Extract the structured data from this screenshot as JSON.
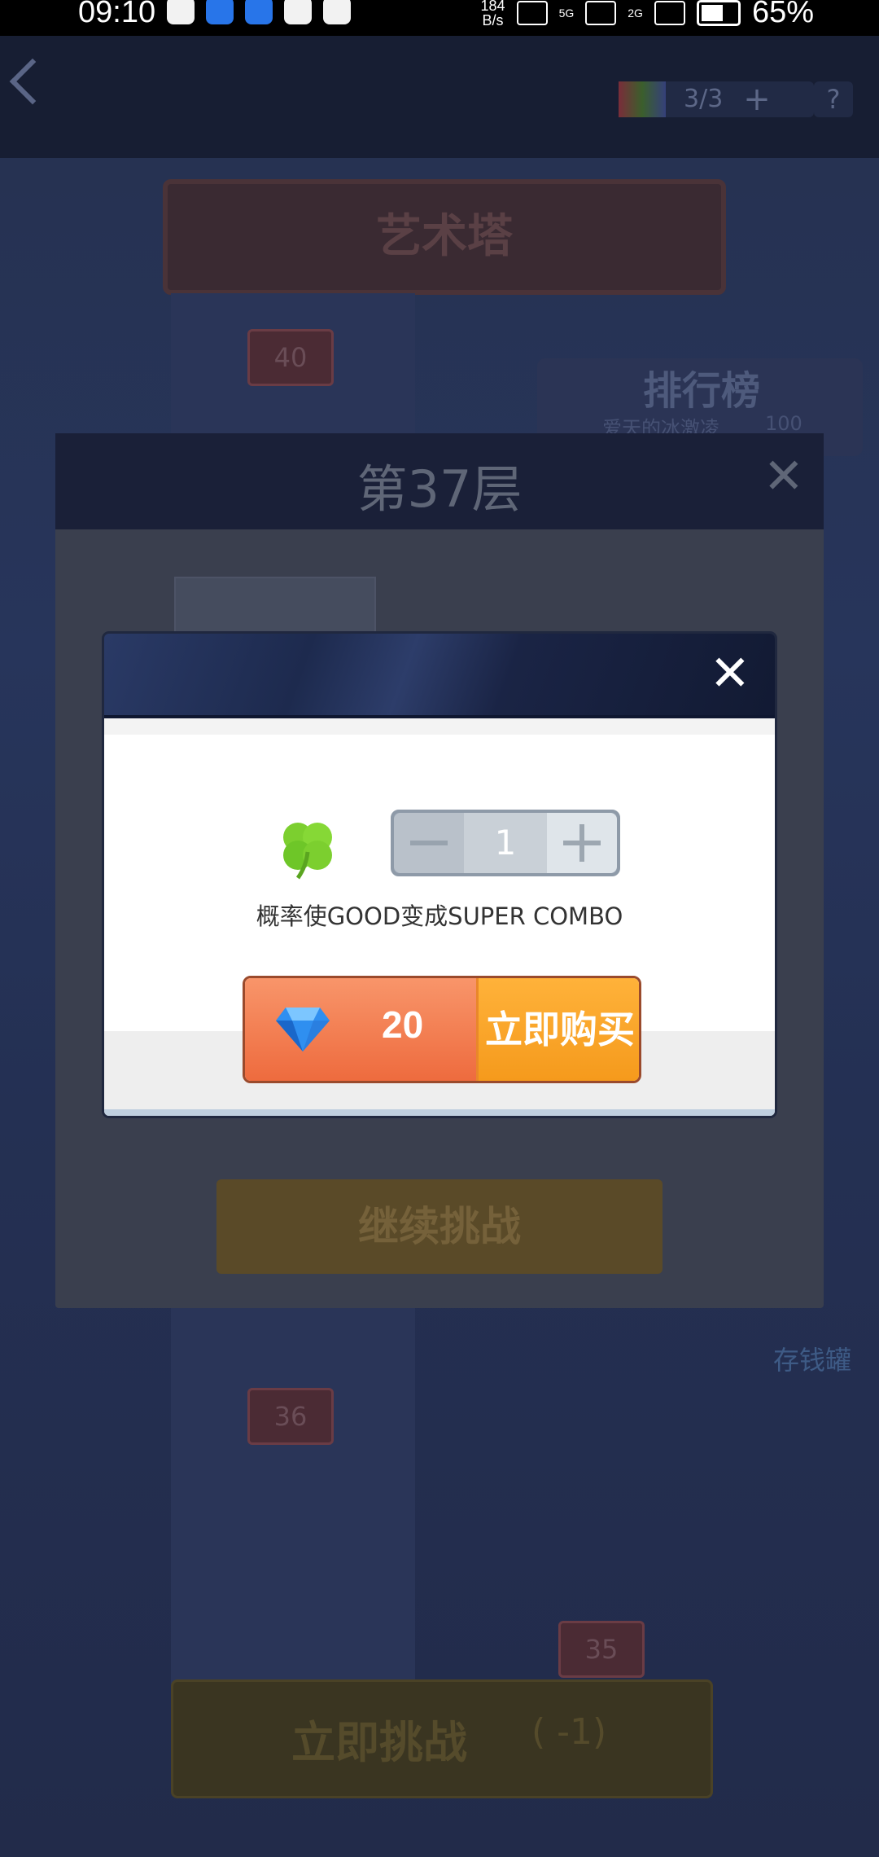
{
  "status_bar": {
    "time": "09:10",
    "net_speed_value": "184",
    "net_speed_unit": "B/s",
    "sim1": "5G",
    "sim2": "2G",
    "battery": "65%"
  },
  "top_bar": {
    "tickets": "3/3",
    "plus": "+",
    "help": "?"
  },
  "scene": {
    "tower_title": "艺术塔",
    "leaderboard_title": "排行榜",
    "leaderboard_player": "爱天的冰激凌",
    "leaderboard_score": "100",
    "floor_40": "40",
    "floor_36": "36",
    "floor_35": "35",
    "piggy_label": "存钱罐",
    "challenge_button": "立即挑战",
    "challenge_cost": "( -1)"
  },
  "level_dialog": {
    "title": "第37层",
    "close": "✕",
    "continue_button": "继续挑战"
  },
  "purchase_popup": {
    "close": "✕",
    "item_icon": "clover-icon",
    "quantity": "1",
    "description": "概率使GOOD变成SUPER COMBO",
    "price": "20",
    "currency_icon": "diamond-icon",
    "buy_button": "立即购买"
  },
  "colors": {
    "buy_orange": "#ee6b3e",
    "buy_yellow": "#f59a1c",
    "popup_header": "#1d2a4e"
  }
}
